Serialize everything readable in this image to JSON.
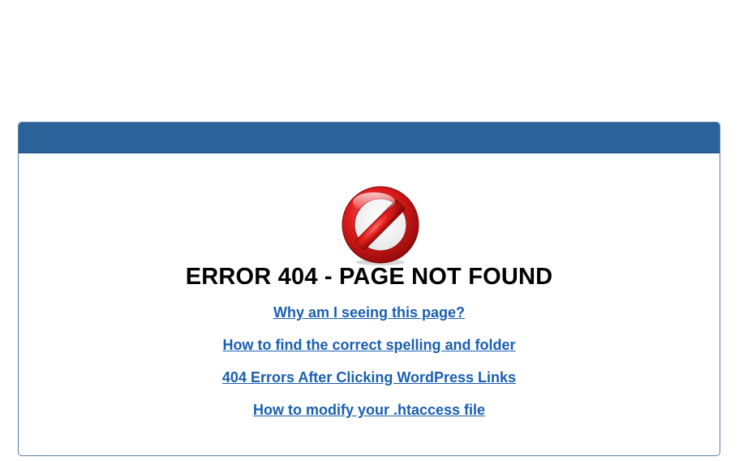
{
  "error": {
    "title": "ERROR 404 - PAGE NOT FOUND",
    "icon": "prohibited-icon"
  },
  "links": [
    {
      "label": "Why am I seeing this page?"
    },
    {
      "label": "How to find the correct spelling and folder"
    },
    {
      "label": "404 Errors After Clicking WordPress Links"
    },
    {
      "label": "How to modify your .htaccess file"
    }
  ],
  "colors": {
    "header_bar": "#2b6299",
    "link": "#1a5fb0",
    "icon_red": "#d01818"
  }
}
